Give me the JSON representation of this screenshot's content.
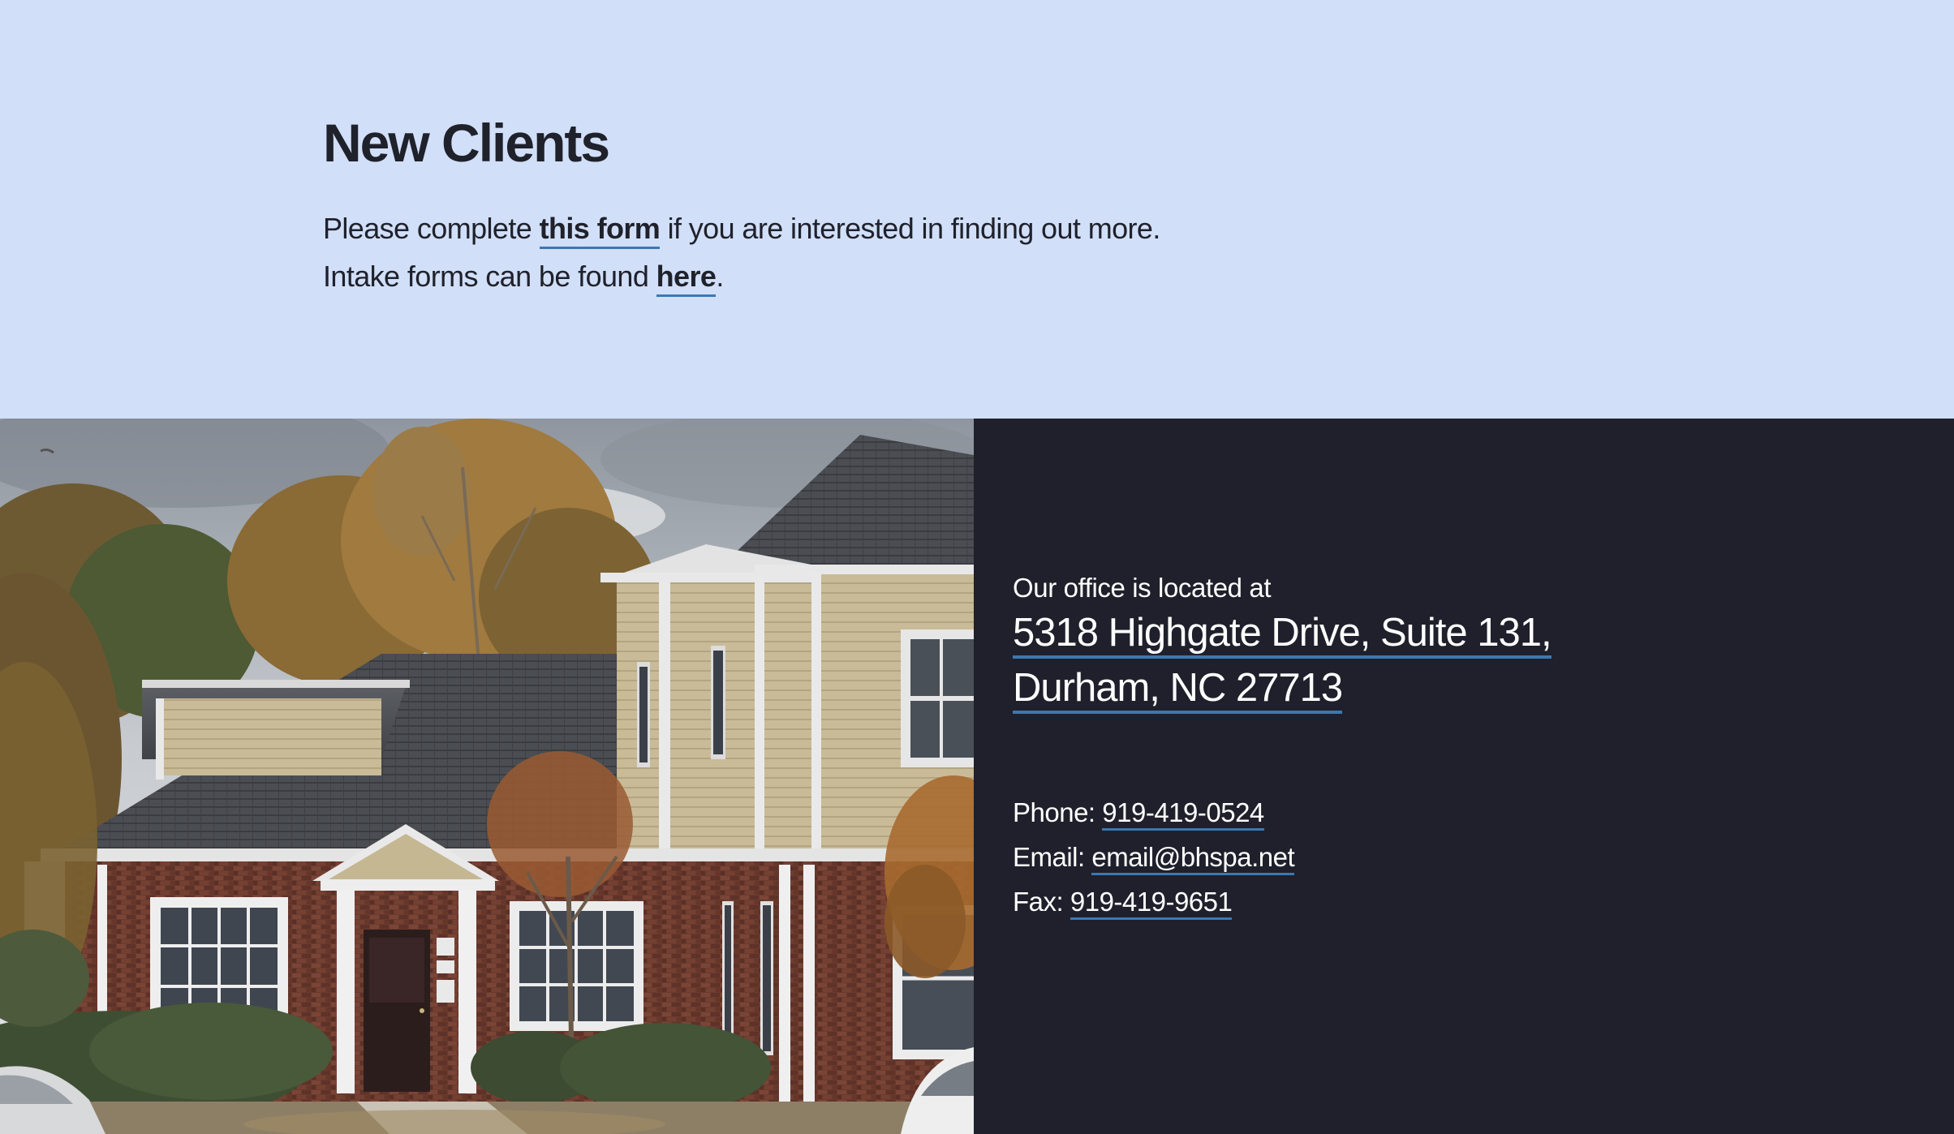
{
  "new_clients": {
    "title": "New Clients",
    "line1_before": "Please complete ",
    "line1_link": "this form",
    "line1_after": " if you are interested in finding out more.",
    "line2_before": "Intake forms can be found ",
    "line2_link": "here",
    "line2_after": "."
  },
  "photo": {
    "subject": "office-building-photo"
  },
  "contact": {
    "location_intro": "Our office is located at",
    "address_line1": "5318 Highgate Drive, Suite 131,",
    "address_line2": "Durham, NC 27713",
    "phone_label": "Phone: ",
    "phone_value": "919-419-0524",
    "email_label": "Email: ",
    "email_value": "email@bhspa.net",
    "fax_label": "Fax: ",
    "fax_value": "919-419-9651"
  },
  "colors": {
    "top_background": "#d1dff8",
    "dark_panel": "#1f202b",
    "link_underline": "#3c78b0",
    "heading_text": "#1f212b"
  }
}
